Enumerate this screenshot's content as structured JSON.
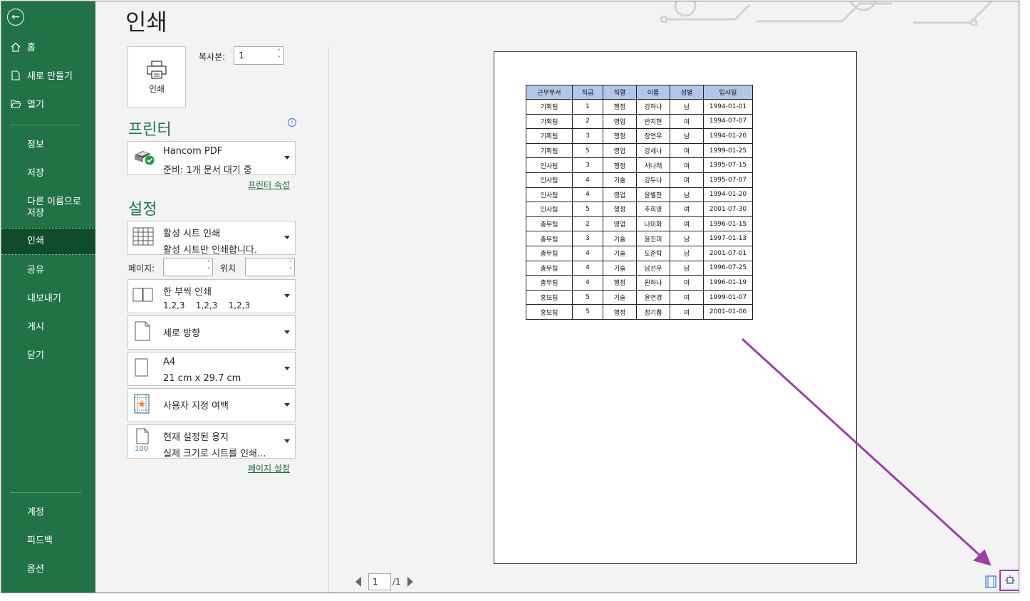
{
  "page": {
    "title": "인쇄"
  },
  "sidebar": {
    "items": [
      {
        "label": "홈"
      },
      {
        "label": "새로 만들기"
      },
      {
        "label": "열기"
      },
      {
        "label": "정보"
      },
      {
        "label": "저장"
      },
      {
        "label": "다른 이름으로\n저장"
      },
      {
        "label": "인쇄"
      },
      {
        "label": "공유"
      },
      {
        "label": "내보내기"
      },
      {
        "label": "게시"
      },
      {
        "label": "닫기"
      },
      {
        "label": "계정"
      },
      {
        "label": "피드백"
      },
      {
        "label": "옵션"
      }
    ]
  },
  "print": {
    "button_label": "인쇄",
    "copies_label": "복사본:",
    "copies_value": "1"
  },
  "printer": {
    "heading": "프린터",
    "name": "Hancom PDF",
    "status": "준비: 1개 문서 대기 중",
    "properties_link": "프린터 속성"
  },
  "settings": {
    "heading": "설정",
    "print_what": {
      "line1": "활성 시트 인쇄",
      "line2": "활성 시트만 인쇄합니다."
    },
    "pages_label": "페이지:",
    "to_label": "위치",
    "collate": {
      "line1": "한 부씩 인쇄",
      "line2": "1,2,3    1,2,3    1,2,3"
    },
    "orientation": {
      "line1": "세로 방향"
    },
    "paper": {
      "line1": "A4",
      "line2": "21 cm x 29.7 cm"
    },
    "margins": {
      "line1": "사용자 지정 여백"
    },
    "scaling": {
      "line1": "현재 설정된 용지",
      "line2": "실제 크기로 시트를 인쇄...",
      "icon_text": "100"
    },
    "page_setup_link": "페이지 설정"
  },
  "preview": {
    "headers": [
      "근무부서",
      "직급",
      "직렬",
      "이름",
      "성별",
      "입사일"
    ],
    "rows": [
      [
        "기획팀",
        "1",
        "행정",
        "강하나",
        "남",
        "1994-01-01"
      ],
      [
        "기획팀",
        "2",
        "영업",
        "반지현",
        "여",
        "1994-07-07"
      ],
      [
        "기획팀",
        "3",
        "행정",
        "장연우",
        "남",
        "1994-01-20"
      ],
      [
        "기획팀",
        "5",
        "영업",
        "강세나",
        "여",
        "1999-01-25"
      ],
      [
        "인사팀",
        "3",
        "행정",
        "서나래",
        "여",
        "1995-07-15"
      ],
      [
        "인사팀",
        "4",
        "기술",
        "강두나",
        "여",
        "1995-07-07"
      ],
      [
        "인사팀",
        "4",
        "영업",
        "윤별찬",
        "남",
        "1994-01-20"
      ],
      [
        "인사팀",
        "5",
        "행정",
        "추희영",
        "여",
        "2001-07-30"
      ],
      [
        "총무팀",
        "2",
        "영업",
        "나미화",
        "여",
        "1996-01-15"
      ],
      [
        "총무팀",
        "3",
        "기술",
        "윤진미",
        "남",
        "1997-01-13"
      ],
      [
        "총무팀",
        "4",
        "기술",
        "도준탁",
        "남",
        "2001-07-01"
      ],
      [
        "총무팀",
        "4",
        "기술",
        "남선우",
        "남",
        "1996-07-25"
      ],
      [
        "총무팀",
        "4",
        "행정",
        "원하나",
        "여",
        "1996-01-19"
      ],
      [
        "홍보팀",
        "5",
        "기술",
        "윤연경",
        "여",
        "1999-01-07"
      ],
      [
        "홍보팀",
        "5",
        "행정",
        "정기뿜",
        "여",
        "2001-01-06"
      ]
    ],
    "current_page": "1",
    "total_pages": "/1"
  },
  "colors": {
    "sidebar": "#217346",
    "accent": "#217346",
    "annotation": "#9b3fa8",
    "header_fill": "#b4c6e7"
  }
}
